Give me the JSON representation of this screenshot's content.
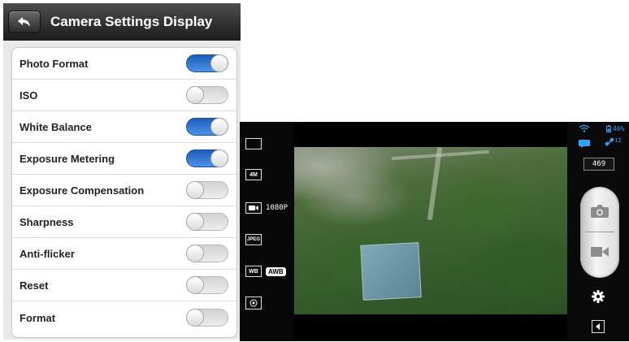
{
  "settings": {
    "title": "Camera Settings Display",
    "rows": [
      {
        "label": "Photo Format",
        "on": true
      },
      {
        "label": "ISO",
        "on": false
      },
      {
        "label": "White Balance",
        "on": true
      },
      {
        "label": "Exposure Metering",
        "on": true
      },
      {
        "label": "Exposure Compensation",
        "on": false
      },
      {
        "label": "Sharpness",
        "on": false
      },
      {
        "label": "Anti-flicker",
        "on": false
      },
      {
        "label": "Reset",
        "on": false
      },
      {
        "label": "Format",
        "on": false
      }
    ]
  },
  "camera": {
    "left_bar": {
      "photo_size_box": "4M",
      "video_resolution": "1080P",
      "format_box": "JPEG",
      "wb_box": "WB",
      "wb_value": "AWB"
    },
    "status": {
      "battery": "46%",
      "satellites": "12",
      "shots_remaining": "469"
    }
  },
  "colors": {
    "toggle_on": "#2f73d6",
    "header_bg": "#2b2b2b",
    "status_blue": "#2fa3ff"
  }
}
